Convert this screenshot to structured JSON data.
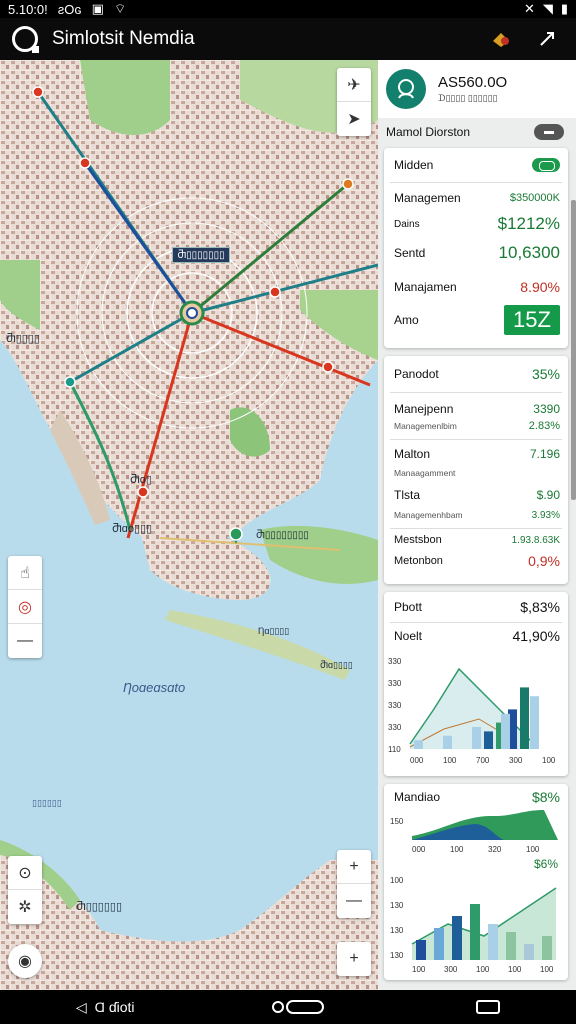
{
  "status_bar": {
    "time": "5.10:0!",
    "carrier": "ƨOɢ",
    "icons": [
      "battery-icon",
      "wifi-icon",
      "signal-icon"
    ]
  },
  "app_bar": {
    "title": "Simlotsit Nemdia"
  },
  "map": {
    "chip_label": "Ⴋ▯▯▯▯▯▯▯",
    "labels": {
      "district_west": "Ⴋ▯▯▯▯",
      "district_south": "Ⴋo▯",
      "district_point": "Ⴋɑo▯▯▯",
      "bay": "Ƞoɑeɑsɑto",
      "coast": "▯▯▯▯▯▯",
      "marker_label": "Ⴋ▯▯▯▯▯▯▯▯",
      "port": "Ƞɑ▯▯▯▯",
      "harbor": "Ⴋɑ▯▯▯▯",
      "south_town": "Ⴋ▯▯▯▯▯▯"
    }
  },
  "panel": {
    "header": {
      "title": "AS560.0O",
      "subtitle": "ᗪ▯▯▯▯ ▯▯▯▯▯▯"
    },
    "subheader": "Mamol Diorston",
    "card1": {
      "rows": [
        {
          "label": "Midden",
          "value": ""
        },
        {
          "label": "Managemen",
          "value": "$350000K"
        },
        {
          "label": "Dains",
          "value": "$1212%"
        },
        {
          "label": "Sentd",
          "value": "10,6300"
        },
        {
          "label": "Manajamen",
          "value": "8.90%"
        },
        {
          "label": "Amo",
          "value": "15Z"
        }
      ]
    },
    "card2": {
      "rows": [
        {
          "label": "Panodot",
          "value": "35%",
          "sub": ""
        },
        {
          "label": "Manejpenn",
          "value": "3390",
          "sub": "Managemenlbim"
        },
        {
          "label": "",
          "value": "2.83%",
          "sub": ""
        },
        {
          "label": "Malton",
          "value": "7.196",
          "sub": "Manaagamment"
        },
        {
          "label": "Tlsta",
          "value": "$.90",
          "sub": "Managemenhbam"
        },
        {
          "label": "",
          "value": "3.93%",
          "sub": ""
        },
        {
          "label": "Mestsbon",
          "value": "1.93.8.63K",
          "sub": ""
        },
        {
          "label": "Metonbon",
          "value": "0,9%",
          "sub": ""
        }
      ]
    },
    "card3": {
      "title": "Pbott",
      "title_value": "$,83%",
      "subtitle": "Noelt",
      "subtitle_value": "41,90%",
      "y_ticks": [
        "330",
        "330",
        "330",
        "330",
        "110"
      ],
      "x_ticks": [
        "000",
        "100",
        "700",
        "300",
        "100"
      ]
    },
    "card4": {
      "title": "Mandiao",
      "title_value": "$8%",
      "value2": "$6%",
      "y_top": "150",
      "x_ticks_top": [
        "000",
        "100",
        "320",
        "100"
      ],
      "y_ticks": [
        "100",
        "130",
        "130",
        "130"
      ],
      "x_ticks": [
        "100",
        "300",
        "100",
        "100",
        "100"
      ]
    }
  },
  "nav_bar": {
    "back_label": "Ɑ ɗioti"
  },
  "colors": {
    "accent_green": "#149a48",
    "route_red": "#d8361f",
    "route_teal": "#1e7f88",
    "route_green": "#2f7d3a",
    "route_blue": "#1e4f9a"
  },
  "chart_data": [
    {
      "type": "bar",
      "title": "Pbott",
      "categories": [
        "000",
        "100",
        "700",
        "300",
        "100"
      ],
      "series": [
        {
          "name": "",
          "values": [
            20,
            30,
            45,
            70,
            95
          ]
        },
        {
          "name": "",
          "values": [
            10,
            15,
            25,
            40,
            60
          ]
        }
      ]
    },
    {
      "type": "area",
      "title": "Mandiao",
      "categories": [
        "100",
        "300",
        "100",
        "100",
        "100"
      ],
      "series": [
        {
          "name": "",
          "values": [
            20,
            45,
            30,
            60,
            90
          ]
        }
      ]
    }
  ]
}
